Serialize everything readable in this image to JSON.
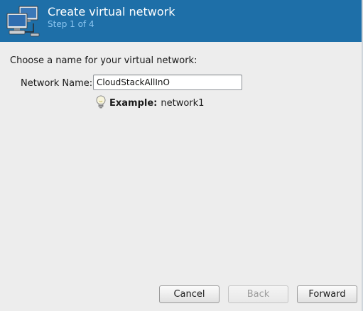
{
  "header": {
    "title": "Create virtual network",
    "subtitle": "Step 1 of 4",
    "icon": "network-computers-icon"
  },
  "form": {
    "prompt": "Choose a name for your virtual network:",
    "name_label": "Network Name:",
    "name_value": "CloudStackAllInO",
    "example_label": "Example:",
    "example_value": "network1"
  },
  "buttons": {
    "cancel": "Cancel",
    "back": "Back",
    "forward": "Forward"
  },
  "colors": {
    "header_bg": "#1e6fa8",
    "subtitle": "#8cc6f0"
  }
}
